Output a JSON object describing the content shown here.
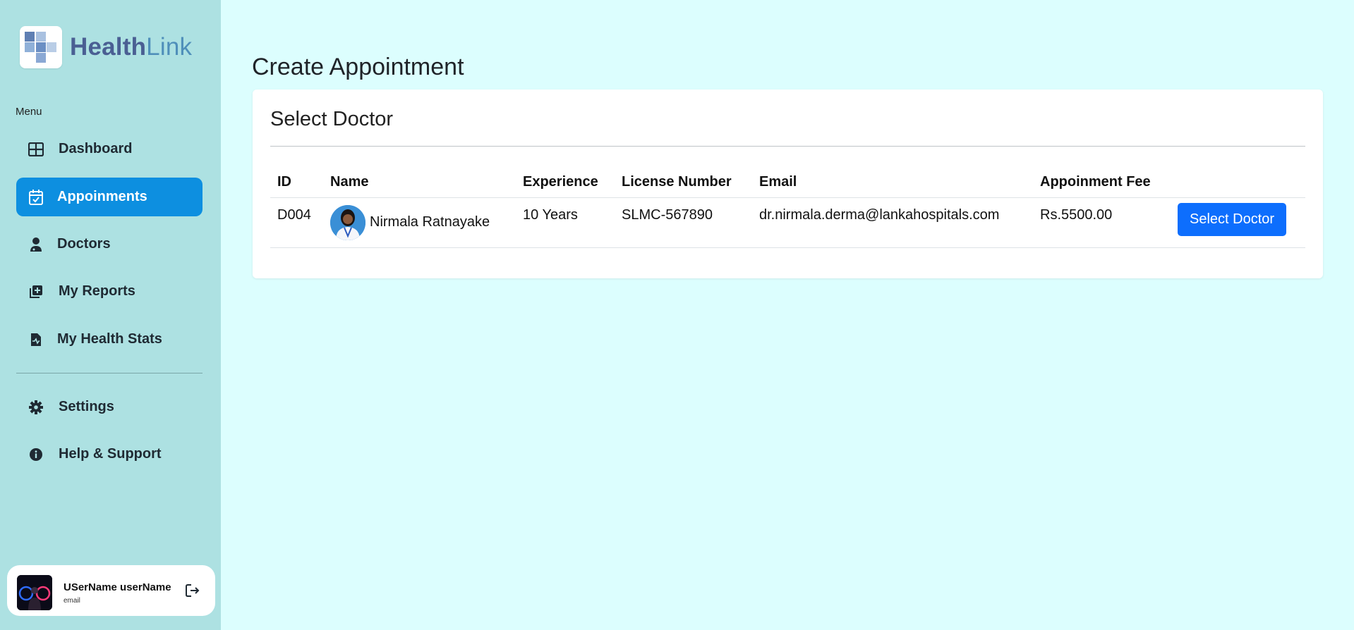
{
  "app": {
    "logo_part1": "Health",
    "logo_part2": "Link"
  },
  "sidebar": {
    "menu_label": "Menu",
    "items": [
      {
        "label": "Dashboard",
        "icon": "grid-icon",
        "active": false
      },
      {
        "label": "Appoinments",
        "icon": "calendar-check-icon",
        "active": true
      },
      {
        "label": "Doctors",
        "icon": "doctor-icon",
        "active": false
      },
      {
        "label": "My Reports",
        "icon": "report-plus-icon",
        "active": false
      },
      {
        "label": "My Health Stats",
        "icon": "file-pulse-icon",
        "active": false
      }
    ],
    "bottom_items": [
      {
        "label": "Settings",
        "icon": "gear-icon"
      },
      {
        "label": "Help & Support",
        "icon": "info-icon"
      }
    ],
    "user": {
      "name": "USerName userName",
      "email": "email"
    }
  },
  "main": {
    "page_title": "Create Appointment",
    "card_title": "Select Doctor",
    "table": {
      "headers": [
        "ID",
        "Name",
        "Experience",
        "License Number",
        "Email",
        "Appoinment Fee",
        ""
      ],
      "rows": [
        {
          "id": "D004",
          "name": "Nirmala Ratnayake",
          "experience": "10 Years",
          "license": "SLMC-567890",
          "email": "dr.nirmala.derma@lankahospitals.com",
          "fee": "Rs.5500.00",
          "action": "Select Doctor"
        }
      ]
    }
  },
  "colors": {
    "sidebar_bg": "#ade1e2",
    "page_bg": "#dcfefe",
    "active_nav": "#0d8fe0",
    "primary_button": "#0d6efd"
  }
}
